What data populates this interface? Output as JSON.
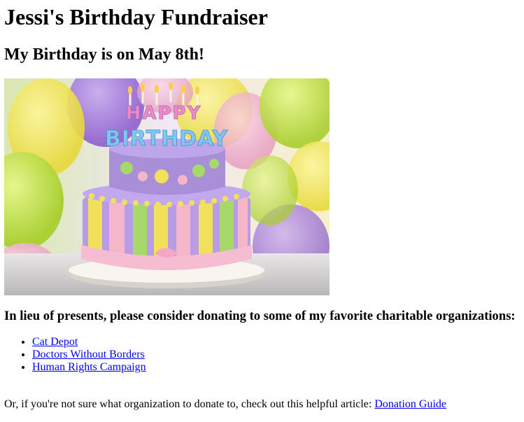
{
  "page": {
    "title": "Jessi's Birthday Fundraiser",
    "subtitle": "My Birthday is on May 8th!"
  },
  "image": {
    "description": "Birthday cake with balloons",
    "cake_letters_top": "HAPPY",
    "cake_letters_bottom": "BIRTHDAY",
    "colors": {
      "purple": "#a98fd8",
      "yellow": "#f1e05a",
      "green": "#a6d96a",
      "pink": "#f4b6c8",
      "lime": "#d6ec4a"
    }
  },
  "donate": {
    "heading": "In lieu of presents, please consider donating to some of my favorite charitable organizations:",
    "organizations": [
      {
        "label": "Cat Depot"
      },
      {
        "label": "Doctors Without Borders"
      },
      {
        "label": "Human Rights Campaign"
      }
    ]
  },
  "footer": {
    "text": "Or, if you're not sure what organization to donate to, check out this helpful article: ",
    "link_label": "Donation Guide"
  }
}
